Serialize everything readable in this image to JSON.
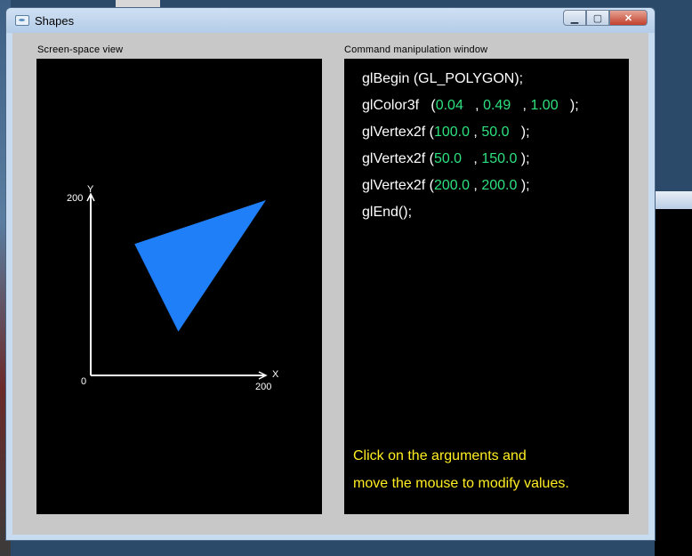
{
  "window": {
    "title": "Shapes",
    "minimize_label": "▁",
    "maximize_label": "▢",
    "close_label": "✕"
  },
  "screen_view": {
    "label": "Screen-space view",
    "axis": {
      "y_label": "Y",
      "x_label": "X",
      "y_max_tick": "200",
      "origin_tick": "0",
      "x_max_tick": "200"
    },
    "triangle": {
      "color": "#1e7ff9",
      "vertices": [
        [
          100,
          50
        ],
        [
          50,
          150
        ],
        [
          200,
          200
        ]
      ]
    }
  },
  "command_window": {
    "label": "Command manipulation window",
    "lines": {
      "begin": "glBegin (GL_POLYGON);",
      "color_fn": "glColor3f",
      "color_args": [
        "0.04",
        "0.49",
        "1.00"
      ],
      "vertex_fn": "glVertex2f",
      "vertex1_args": [
        "100.0",
        "50.0"
      ],
      "vertex2_args": [
        "50.0",
        "150.0"
      ],
      "vertex3_args": [
        "200.0",
        "200.0"
      ],
      "end": "glEnd();"
    },
    "hint_line1": "Click on the arguments and",
    "hint_line2": "move the mouse to modify values."
  }
}
